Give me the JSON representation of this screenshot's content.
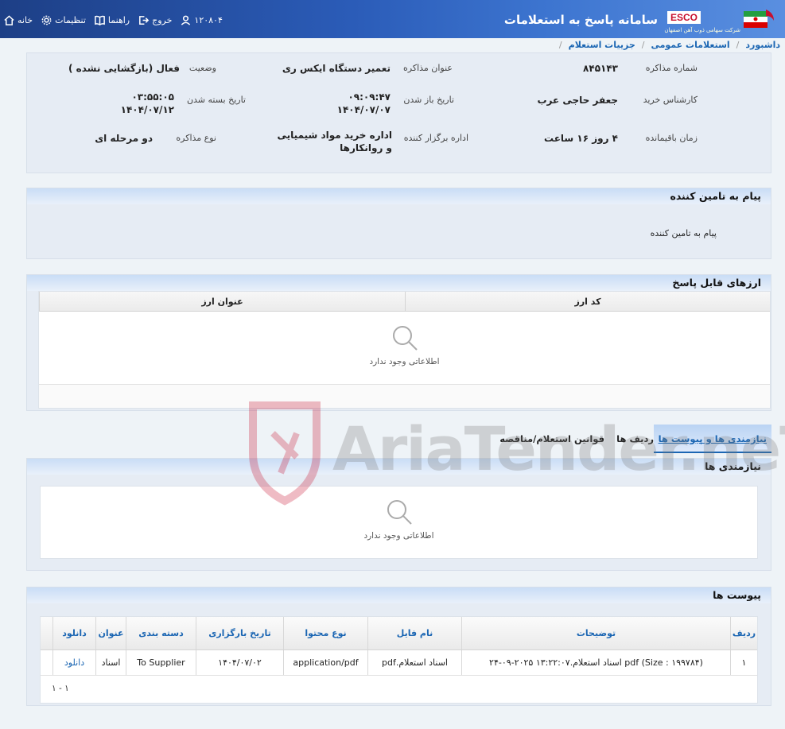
{
  "header": {
    "app_title": "سامانه پاسخ به استعلامات",
    "brand": "ESCO",
    "brand_sub": "شرکت سهامی ذوب آهن اصفهان",
    "nav": [
      {
        "label": "خانه",
        "icon": "home-icon"
      },
      {
        "label": "تنظیمات",
        "icon": "gear-icon"
      },
      {
        "label": "راهنما",
        "icon": "book-icon"
      },
      {
        "label": "خروج",
        "icon": "logout-icon"
      },
      {
        "label": "۱۲۰۸۰۴",
        "icon": "user-icon"
      }
    ]
  },
  "breadcrumb": [
    "داشبورد",
    "استعلامات عمومی",
    "جزییات استعلام"
  ],
  "details": {
    "negotiation_number": {
      "label": "شماره مذاکره",
      "value": "۸۴۵۱۴۳"
    },
    "negotiation_title": {
      "label": "عنوان مذاکره",
      "value": "تعمیر دستگاه ایکس ری"
    },
    "status": {
      "label": "وضعیت",
      "value": "فعال (بازگشایی نشده )"
    },
    "purchase_expert": {
      "label": "کارشناس خرید",
      "value": "جعفر حاجی عرب"
    },
    "open_date": {
      "label": "تاریخ باز شدن",
      "time": "۰۹:۰۹:۴۷",
      "date": "۱۴۰۴/۰۷/۰۷"
    },
    "close_date": {
      "label": "تاریخ بسته شدن",
      "time": "۰۳:۵۵:۰۵",
      "date": "۱۴۰۴/۰۷/۱۲"
    },
    "remaining": {
      "label": "زمان باقیمانده",
      "value": "۴ روز ۱۶ ساعت"
    },
    "organizer": {
      "label": "اداره برگزار کننده",
      "line1": "اداره خرید مواد شیمیایی",
      "line2": "و روانکارها"
    },
    "negotiation_type": {
      "label": "نوع مذاکره",
      "value": "دو مرحله ای"
    }
  },
  "supplier_message": {
    "title": "پیام به تامین کننده",
    "text": "پیام به تامین کننده"
  },
  "currencies": {
    "title": "ارزهای قابل پاسخ",
    "columns": [
      "کد ارز",
      "عنوان ارز"
    ],
    "empty_text": "اطلاعاتی وجود ندارد"
  },
  "tabs": [
    "نیازمندی ها و پیوست ها",
    "ردیف ها",
    "قوانین استعلام/مناقصه"
  ],
  "needs": {
    "title": "نیازمندی ها",
    "empty_text": "اطلاعاتی وجود ندارد"
  },
  "attachments": {
    "title": "پیوست ها",
    "columns": [
      "ردیف",
      "توضیحات",
      "نام فایل",
      "نوع محتوا",
      "تاریخ بارگزاری",
      "دسته بندی",
      "عنوان",
      "دانلود"
    ],
    "rows": [
      [
        "۱",
        "pdf (Size : ۱۹۹۷۸۴) اسناد استعلام.۱۳:۲۲:۰۷ ۲۰۲۵-۰۹-۲۴",
        "اسناد استعلام.pdf",
        "application/pdf",
        "۱۴۰۴/۰۷/۰۲",
        "To Supplier",
        "اسناد",
        "دانلود"
      ]
    ],
    "pager": "۱ - ۱"
  },
  "watermark": "AriaTender.neT",
  "colors": {
    "accent": "#1b66b3",
    "header": "#2b5cb8",
    "brand_red": "#c8102e"
  }
}
